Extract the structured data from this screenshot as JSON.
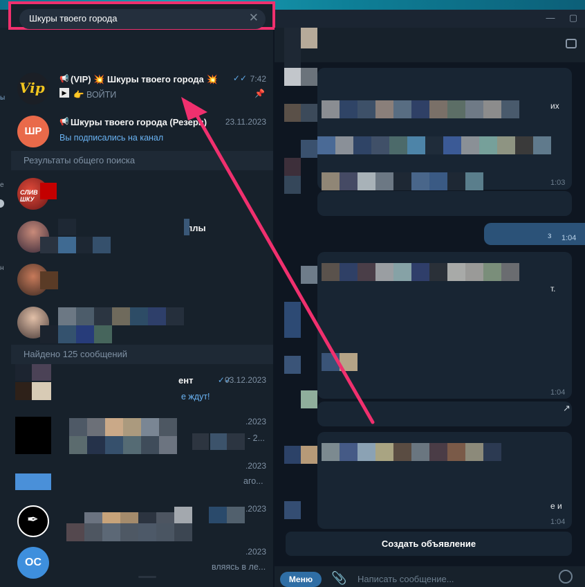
{
  "window": {
    "minimize_glyph": "—",
    "maximize_glyph": "▢"
  },
  "left_strip": {
    "fragments": [
      "ы",
      "е",
      "н"
    ]
  },
  "search": {
    "value": "Шкуры твоего города",
    "clear_glyph": "✕"
  },
  "results": [
    {
      "title": "(VIP) 💥 Шкуры твоего города 💥",
      "subtitle": "👉 ВОЙТИ",
      "time": "7:42",
      "avatar": "Vip",
      "pinned": true,
      "read": true
    },
    {
      "title": "Шкуры твоего города (Резерв)",
      "subtitle": "Вы подписались на канал",
      "time": "23.11.2023",
      "avatar": "ШР",
      "avatar_color": "#e96a4a"
    }
  ],
  "global_section": "Результаты общего поиска",
  "global_items": [
    {
      "title": "",
      "subtitle": "",
      "avatar_text": "СЛИВ ШКУ"
    },
    {
      "title": "ллы",
      "subtitle": ""
    },
    {
      "title": "",
      "subtitle": ""
    },
    {
      "title": "",
      "subtitle": ""
    }
  ],
  "messages_section": "Найдено 125 сообщений",
  "message_items": [
    {
      "title": "ент",
      "subtitle": "е ждут!",
      "time": "03.12.2023",
      "read": true
    },
    {
      "title": "",
      "subtitle": "- 2...",
      "time": ".2023"
    },
    {
      "title": "",
      "subtitle": "аго...",
      "time": ".2023"
    },
    {
      "title": "",
      "subtitle": "",
      "time": ".2023"
    },
    {
      "title": "",
      "subtitle": "вляясь в ле...",
      "time": ".2023",
      "avatar": "ОС",
      "avatar_color": "#3e8fdd"
    }
  ],
  "chat": {
    "bubble_times": [
      "1:03",
      "1:04",
      "1:04",
      "1:04"
    ],
    "fragments": [
      "их",
      "т.",
      "е и",
      "з"
    ],
    "create_ad": "Создать объявление",
    "menu_button": "Меню",
    "composer_placeholder": "Написать сообщение..."
  }
}
